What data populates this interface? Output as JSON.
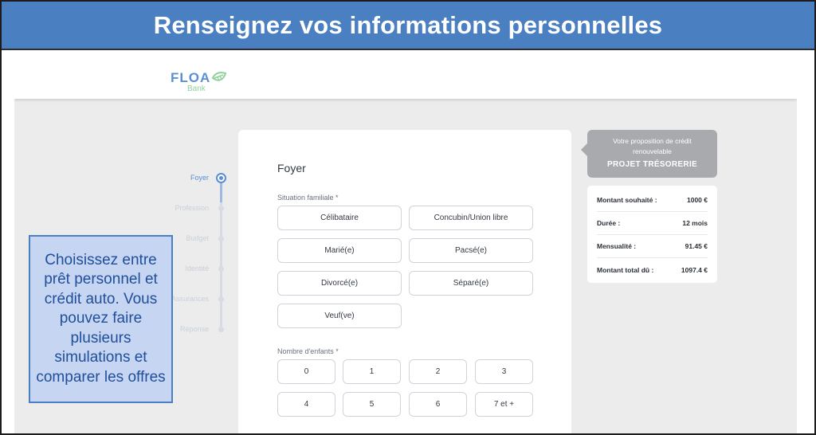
{
  "banner": {
    "title": "Renseignez vos informations personnelles"
  },
  "brand": {
    "name": "FLOA",
    "sub": "Bank",
    "leaf_icon": "leaf-icon",
    "colors": {
      "blue": "#5a8fd6",
      "green": "#8fd19a"
    }
  },
  "stepper": {
    "steps": [
      {
        "label": "Foyer",
        "active": true
      },
      {
        "label": "Profession",
        "active": false
      },
      {
        "label": "Budget",
        "active": false
      },
      {
        "label": "Identité",
        "active": false
      },
      {
        "label": "Assurances",
        "active": false
      },
      {
        "label": "Réponse",
        "active": false
      }
    ]
  },
  "form": {
    "title": "Foyer",
    "situation_label": "Situation familiale *",
    "situation_options": [
      "Célibataire",
      "Concubin/Union libre",
      "Marié(e)",
      "Pacsé(e)",
      "Divorcé(e)",
      "Séparé(e)",
      "Veuf(ve)"
    ],
    "children_label": "Nombre d'enfants *",
    "children_options": [
      "0",
      "1",
      "2",
      "3",
      "4",
      "5",
      "6",
      "7 et +"
    ]
  },
  "offer": {
    "subtitle": "Votre proposition de crédit renouvelable",
    "title": "PROJET TRÉSORERIE",
    "rows": [
      {
        "label": "Montant souhaité :",
        "value": "1000 €"
      },
      {
        "label": "Durée :",
        "value": "12 mois"
      },
      {
        "label": "Mensualité :",
        "value": "91.45 €"
      },
      {
        "label": "Montant total dû :",
        "value": "1097.4 €"
      }
    ]
  },
  "callout": {
    "text": "Choisissez entre prêt personnel et crédit auto. Vous pouvez faire plusieurs simulations et comparer les offres"
  },
  "colors": {
    "banner": "#4a7fc1",
    "callout_bg": "#c6d5f2",
    "callout_text": "#1f4f9a",
    "tooltip": "#a8aaad",
    "page_bg": "#ececec"
  }
}
